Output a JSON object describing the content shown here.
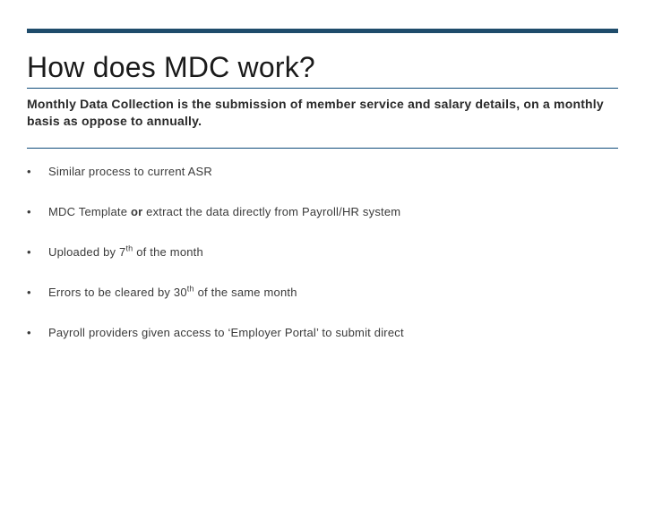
{
  "title": "How does MDC work?",
  "subtitle": "Monthly Data Collection is the submission of member service and salary details, on a monthly basis as oppose to annually.",
  "bullets": {
    "b0": "Similar process to current ASR",
    "b1_pre": "MDC Template ",
    "b1_bold": "or",
    "b1_post": " extract the data directly from Payroll/HR system",
    "b2_pre": "Uploaded by 7",
    "b2_sup": "th",
    "b2_post": " of the month",
    "b3_pre": "Errors to be cleared by 30",
    "b3_sup": "th",
    "b3_post": " of the same month",
    "b4": "Payroll providers given access to ‘Employer Portal’ to submit direct"
  }
}
